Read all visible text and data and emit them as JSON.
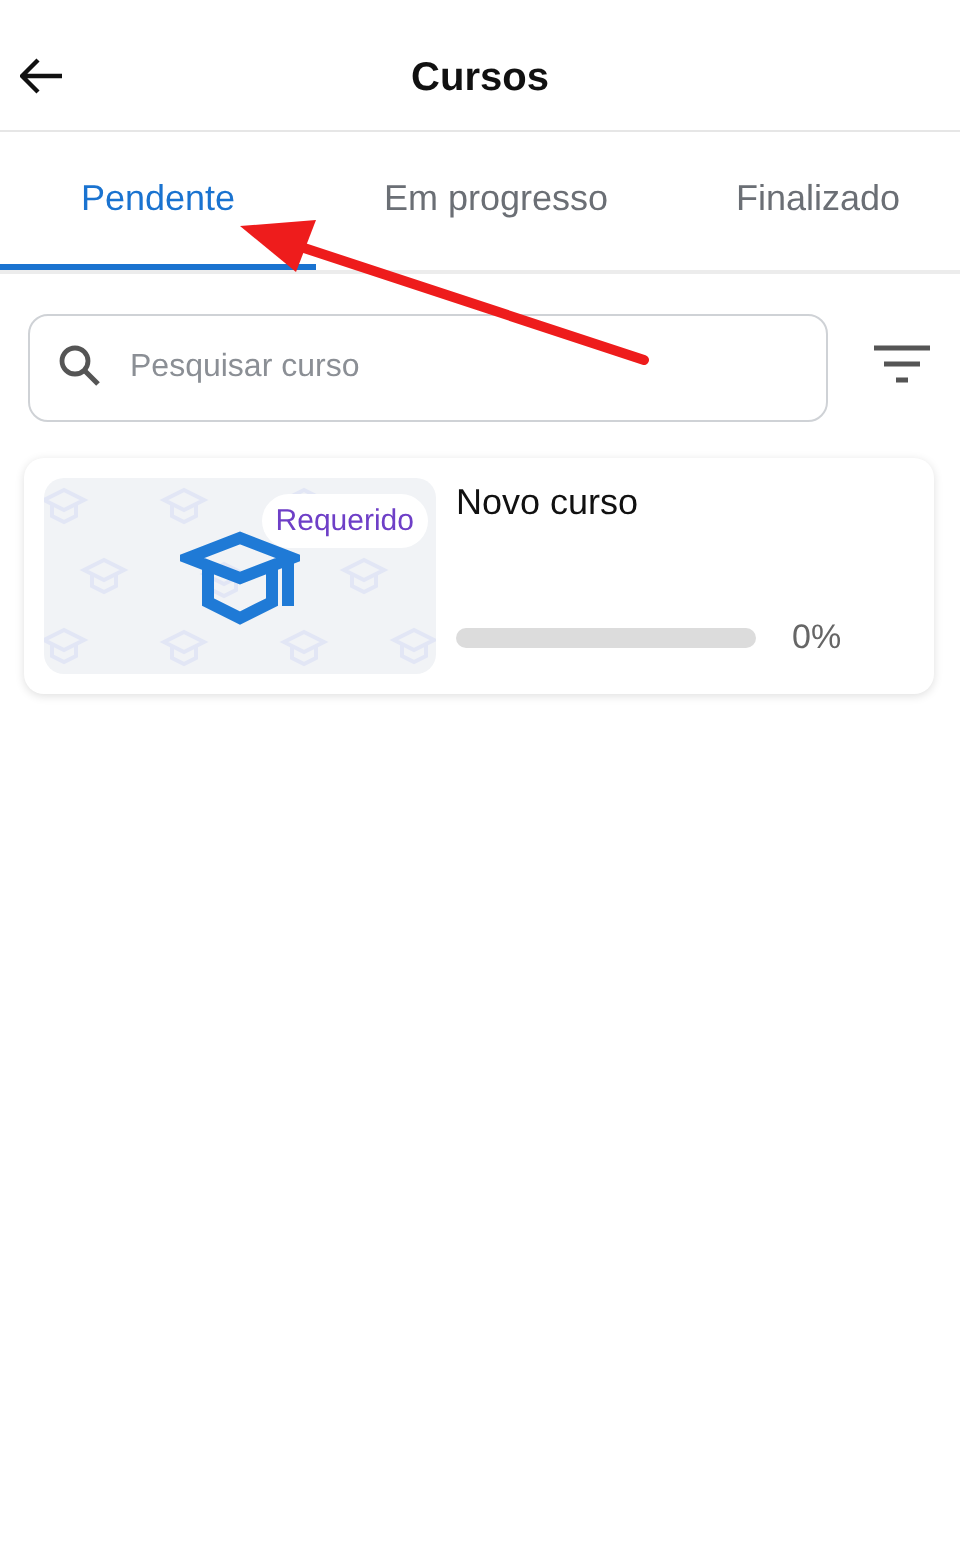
{
  "header": {
    "title": "Cursos"
  },
  "tabs": [
    {
      "label": "Pendente",
      "selected": true
    },
    {
      "label": "Em progresso",
      "selected": false
    },
    {
      "label": "Finalizado",
      "selected": false
    }
  ],
  "search": {
    "placeholder": "Pesquisar curso"
  },
  "courses": [
    {
      "title": "Novo curso",
      "badge": "Requerido",
      "level": 0,
      "reading": "0%"
    }
  ]
}
